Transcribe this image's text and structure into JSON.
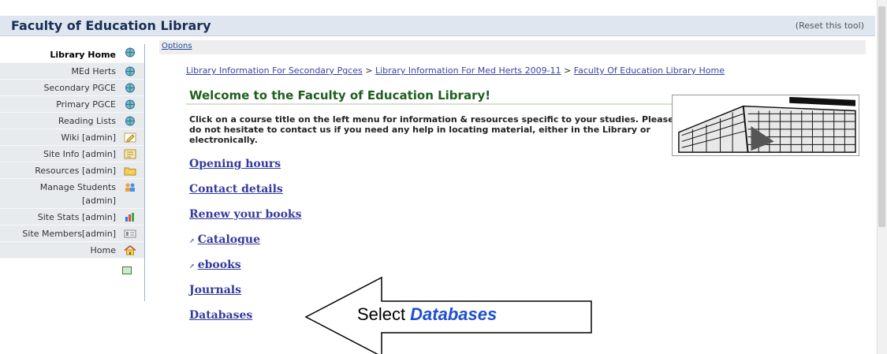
{
  "window": {
    "title": "Faculty of Education Library",
    "reset": "(Reset this tool)"
  },
  "options": {
    "label": "Options"
  },
  "sidebar": {
    "items": [
      {
        "label": "Library Home",
        "icon": "globe-icon"
      },
      {
        "label": "MEd Herts",
        "icon": "globe-icon"
      },
      {
        "label": "Secondary PGCE",
        "icon": "globe-icon"
      },
      {
        "label": "Primary PGCE",
        "icon": "globe-icon"
      },
      {
        "label": "Reading Lists",
        "icon": "globe-icon"
      },
      {
        "label": "Wiki [admin]",
        "icon": "pencil-icon"
      },
      {
        "label": "Site Info [admin]",
        "icon": "info-icon"
      },
      {
        "label": "Resources [admin]",
        "icon": "folder-icon"
      },
      {
        "label": "Manage Students",
        "label2": "[admin]",
        "icon": "users-icon"
      },
      {
        "label": "Site Stats [admin]",
        "icon": "bar-chart-icon"
      },
      {
        "label": "Site Members[admin]",
        "icon": "members-icon"
      },
      {
        "label": "Home",
        "icon": "house-icon"
      }
    ]
  },
  "breadcrumb": {
    "items": [
      "Library Information For Secondary Pgces",
      "Library Information For Med Herts 2009-11",
      "Faculty Of Education Library Home"
    ],
    "separator": ">"
  },
  "main": {
    "heading": "Welcome to the Faculty of Education Library!",
    "intro": "Click on a course title on the left menu for information & resources specific to your studies. Please do not hesitate to contact us if you need any help in locating material, either in the Library or electronically.",
    "links": [
      {
        "label": "Opening hours",
        "external": false
      },
      {
        "label": "Contact details",
        "external": false
      },
      {
        "label": "Renew your books",
        "external": false
      },
      {
        "label": "Catalogue",
        "external": true
      },
      {
        "label": "ebooks",
        "external": true
      },
      {
        "label": "Journals",
        "external": false
      },
      {
        "label": "Databases",
        "external": false
      }
    ],
    "external_glyph": "↗"
  },
  "callout": {
    "prefix": "Select",
    "emphasis": "Databases"
  },
  "colors": {
    "title": "#1a2f55",
    "heading": "#1f5f1f",
    "link": "#343a9b",
    "callout_emphasis": "#1e4fd1"
  }
}
